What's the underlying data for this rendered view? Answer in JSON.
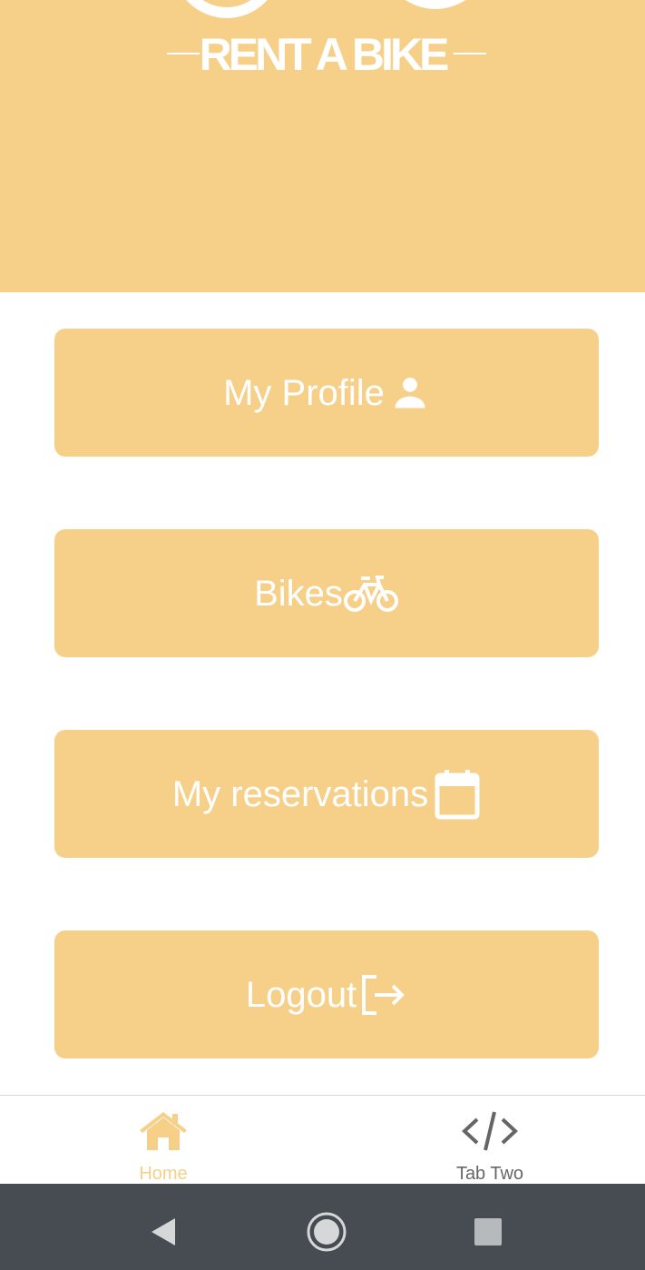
{
  "header": {
    "logo_text": "RENT A BIKE",
    "background_color": "#f6d089"
  },
  "menu": {
    "buttons": [
      {
        "label": "My Profile",
        "icon": "person-icon"
      },
      {
        "label": "Bikes",
        "icon": "bicycle-icon"
      },
      {
        "label": "My reservations",
        "icon": "calendar-icon"
      },
      {
        "label": "Logout",
        "icon": "logout-icon"
      }
    ]
  },
  "tabs": [
    {
      "label": "Home",
      "icon": "home-icon",
      "active": true,
      "color": "#f6d089"
    },
    {
      "label": "Tab Two",
      "icon": "code-icon",
      "active": false,
      "color": "#666666"
    }
  ],
  "system_nav": {
    "back_icon": "back-triangle-icon",
    "home_icon": "home-circle-icon",
    "recents_icon": "recents-square-icon",
    "background_color": "#464c51"
  }
}
